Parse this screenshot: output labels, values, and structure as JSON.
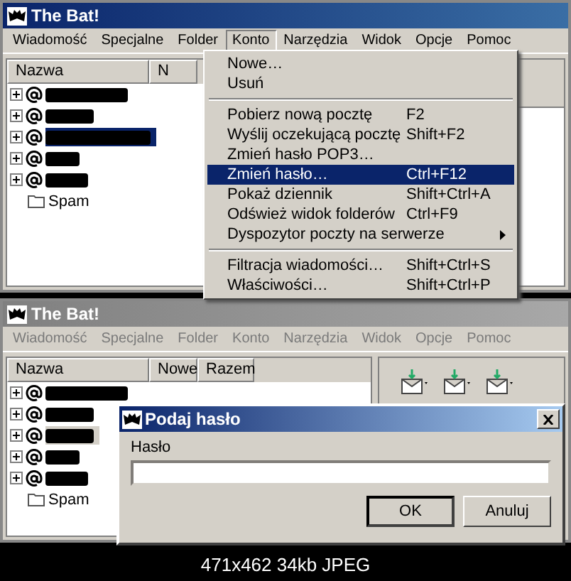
{
  "windows": [
    {
      "title": "The Bat!",
      "active": true,
      "menu": [
        {
          "label": "Wiadomość",
          "selected": false
        },
        {
          "label": "Specjalne",
          "selected": false
        },
        {
          "label": "Folder",
          "selected": false
        },
        {
          "label": "Konto",
          "selected": true
        },
        {
          "label": "Narzędzia",
          "selected": false
        },
        {
          "label": "Widok",
          "selected": false
        },
        {
          "label": "Opcje",
          "selected": false
        },
        {
          "label": "Pomoc",
          "selected": false
        }
      ],
      "columns": [
        "Nazwa",
        "N"
      ],
      "folders": [
        {
          "kind": "account",
          "selected": false
        },
        {
          "kind": "account",
          "selected": false
        },
        {
          "kind": "account",
          "selected": true
        },
        {
          "kind": "account",
          "selected": false
        },
        {
          "kind": "account",
          "selected": false
        },
        {
          "kind": "folder",
          "label": "Spam",
          "selected": false
        }
      ],
      "dropdown": [
        {
          "kind": "item",
          "label": "Nowe…",
          "selected": false
        },
        {
          "kind": "item",
          "label": "Usuń",
          "selected": false
        },
        {
          "kind": "separator"
        },
        {
          "kind": "item",
          "label": "Pobierz nową pocztę",
          "shortcut": "F2",
          "selected": false
        },
        {
          "kind": "item",
          "label": "Wyślij oczekującą pocztę",
          "shortcut": "Shift+F2",
          "selected": false
        },
        {
          "kind": "item",
          "label": "Zmień hasło POP3…",
          "selected": false
        },
        {
          "kind": "item",
          "label": "Zmień hasło…",
          "shortcut": "Ctrl+F12",
          "selected": true
        },
        {
          "kind": "item",
          "label": "Pokaż dziennik",
          "shortcut": "Shift+Ctrl+A",
          "selected": false
        },
        {
          "kind": "item",
          "label": "Odśwież widok folderów",
          "shortcut": "Ctrl+F9",
          "selected": false
        },
        {
          "kind": "submenu",
          "label": "Dyspozytor poczty na serwerze",
          "selected": false
        },
        {
          "kind": "separator"
        },
        {
          "kind": "item",
          "label": "Filtracja wiadomości…",
          "shortcut": "Shift+Ctrl+S",
          "selected": false
        },
        {
          "kind": "item",
          "label": "Właściwości…",
          "shortcut": "Shift+Ctrl+P",
          "selected": false
        }
      ]
    },
    {
      "title": "The Bat!",
      "active": false,
      "menu": [
        {
          "label": "Wiadomość",
          "selected": false
        },
        {
          "label": "Specjalne",
          "selected": false
        },
        {
          "label": "Folder",
          "selected": false
        },
        {
          "label": "Konto",
          "selected": false
        },
        {
          "label": "Narzędzia",
          "selected": false
        },
        {
          "label": "Widok",
          "selected": false
        },
        {
          "label": "Opcje",
          "selected": false
        },
        {
          "label": "Pomoc",
          "selected": false
        }
      ],
      "columns": [
        "Nazwa",
        "Nowe",
        "Razem"
      ],
      "folders": [
        {
          "kind": "account",
          "selected": false
        },
        {
          "kind": "account",
          "selected": false
        },
        {
          "kind": "account",
          "selected": true
        },
        {
          "kind": "account",
          "selected": false
        },
        {
          "kind": "account",
          "selected": false
        },
        {
          "kind": "folder",
          "label": "Spam",
          "selected": false
        }
      ],
      "dialog": {
        "title": "Podaj hasło",
        "field_label": "Hasło",
        "buttons": [
          {
            "label": "OK",
            "default": true
          },
          {
            "label": "Anuluj",
            "default": false
          }
        ]
      }
    }
  ],
  "caption": "471x462 34kb JPEG"
}
